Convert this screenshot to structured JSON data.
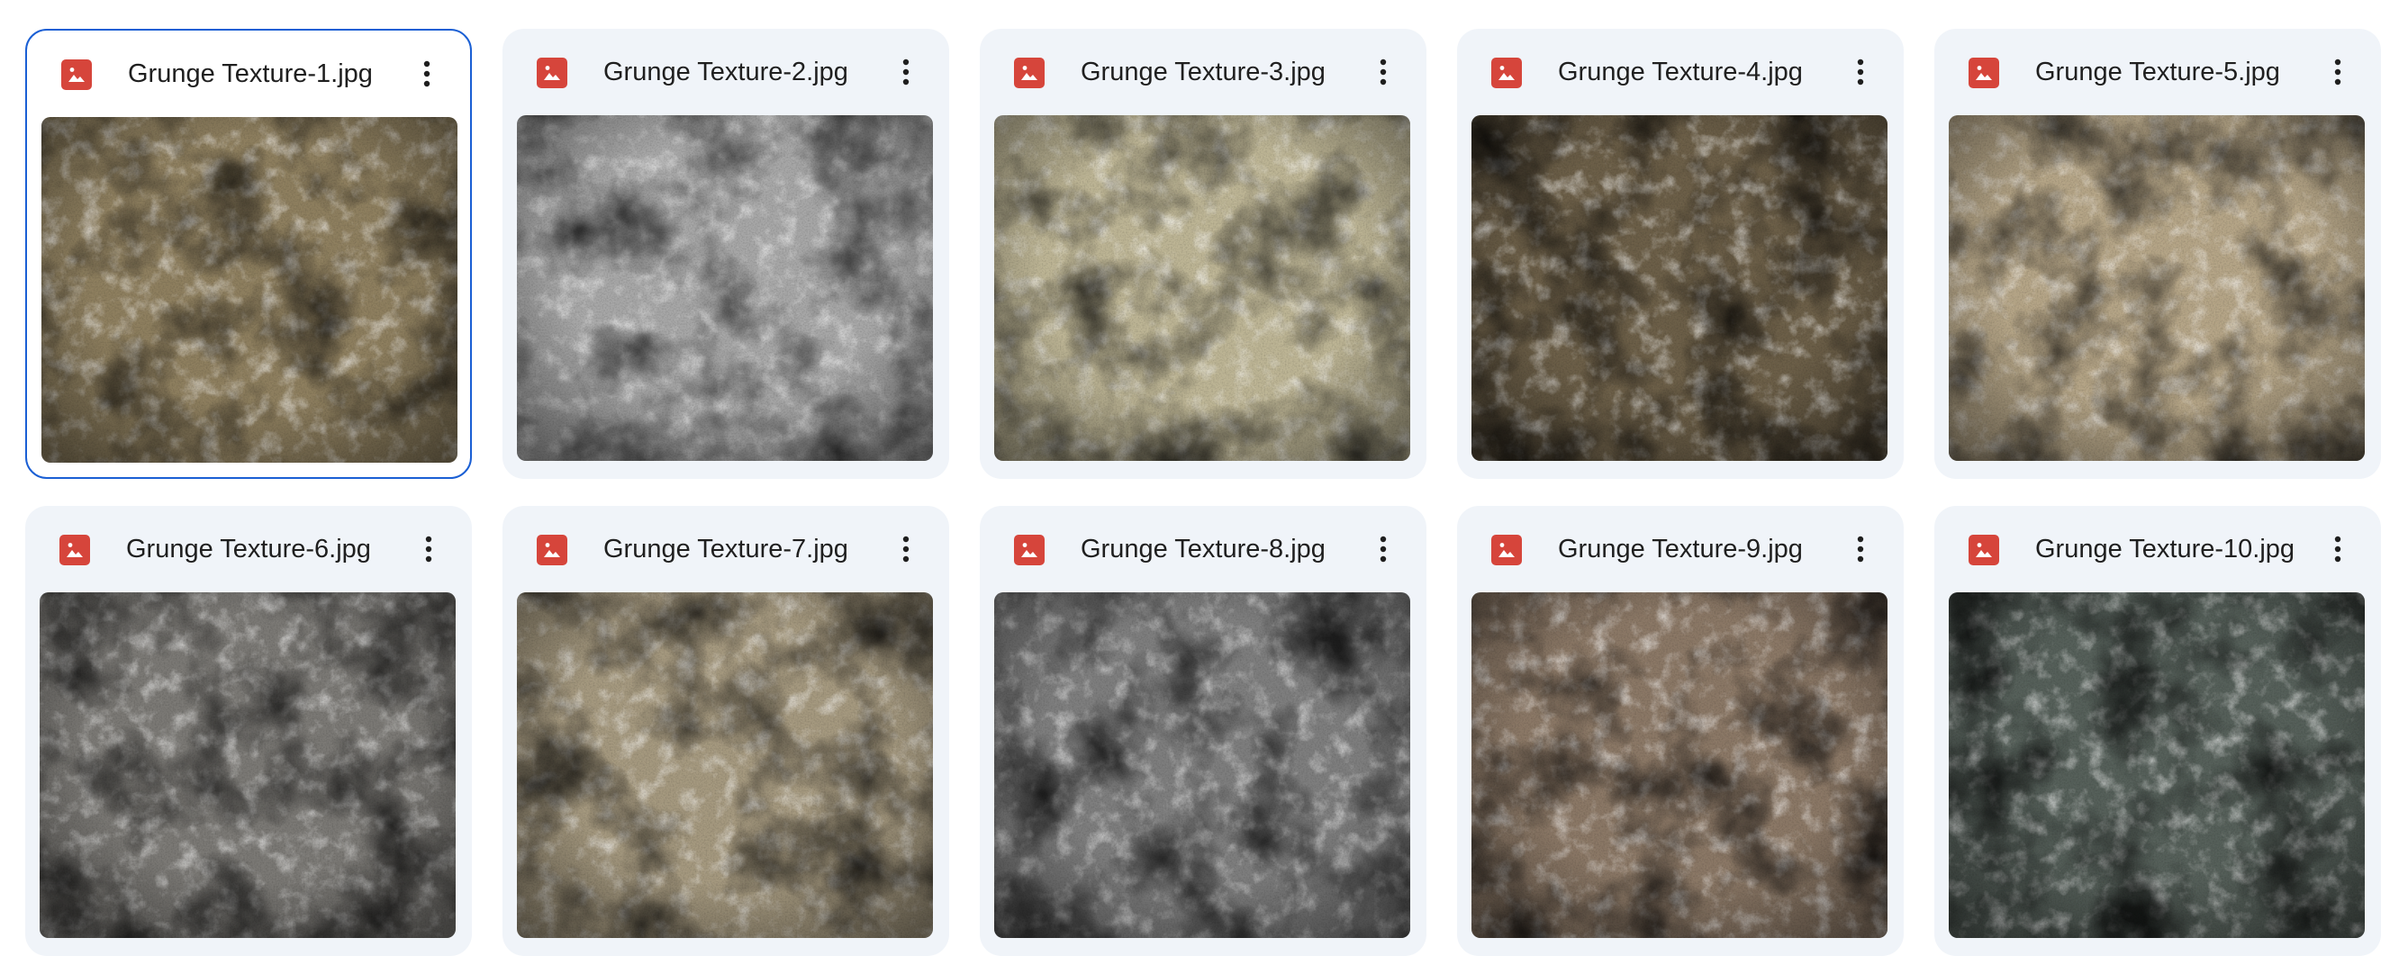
{
  "files": [
    {
      "name": "Grunge Texture-1.jpg",
      "selected": true,
      "colors": [
        "#8e7f5f",
        "#4a4331",
        "#c9bd9e"
      ]
    },
    {
      "name": "Grunge Texture-2.jpg",
      "selected": false,
      "colors": [
        "#a7a7a7",
        "#5b5b5b",
        "#dcdcdc"
      ]
    },
    {
      "name": "Grunge Texture-3.jpg",
      "selected": false,
      "colors": [
        "#bdb595",
        "#3b3a31",
        "#e0d7b8"
      ]
    },
    {
      "name": "Grunge Texture-4.jpg",
      "selected": false,
      "colors": [
        "#6c5f48",
        "#3a3226",
        "#8a7c62"
      ]
    },
    {
      "name": "Grunge Texture-5.jpg",
      "selected": false,
      "colors": [
        "#b5a587",
        "#4d4136",
        "#ddd0b4"
      ]
    },
    {
      "name": "Grunge Texture-6.jpg",
      "selected": false,
      "colors": [
        "#7b7975",
        "#2c2b29",
        "#c4c2bd"
      ]
    },
    {
      "name": "Grunge Texture-7.jpg",
      "selected": false,
      "colors": [
        "#a5997f",
        "#6d624f",
        "#d2c6ad"
      ]
    },
    {
      "name": "Grunge Texture-8.jpg",
      "selected": false,
      "colors": [
        "#7e7e7e",
        "#3e3e3e",
        "#b2b2b2"
      ]
    },
    {
      "name": "Grunge Texture-9.jpg",
      "selected": false,
      "colors": [
        "#8b7866",
        "#4f4236",
        "#b8a794"
      ]
    },
    {
      "name": "Grunge Texture-10.jpg",
      "selected": false,
      "colors": [
        "#56605a",
        "#2f3631",
        "#8a948c"
      ]
    }
  ],
  "icons": {
    "file_type": "image-file-icon",
    "more": "more-vertical-icon"
  },
  "colors": {
    "card_bg": "#f0f4f9",
    "selected_border": "#1a5fd4",
    "image_icon_red": "#d6453b",
    "text": "#1f1f1f"
  }
}
